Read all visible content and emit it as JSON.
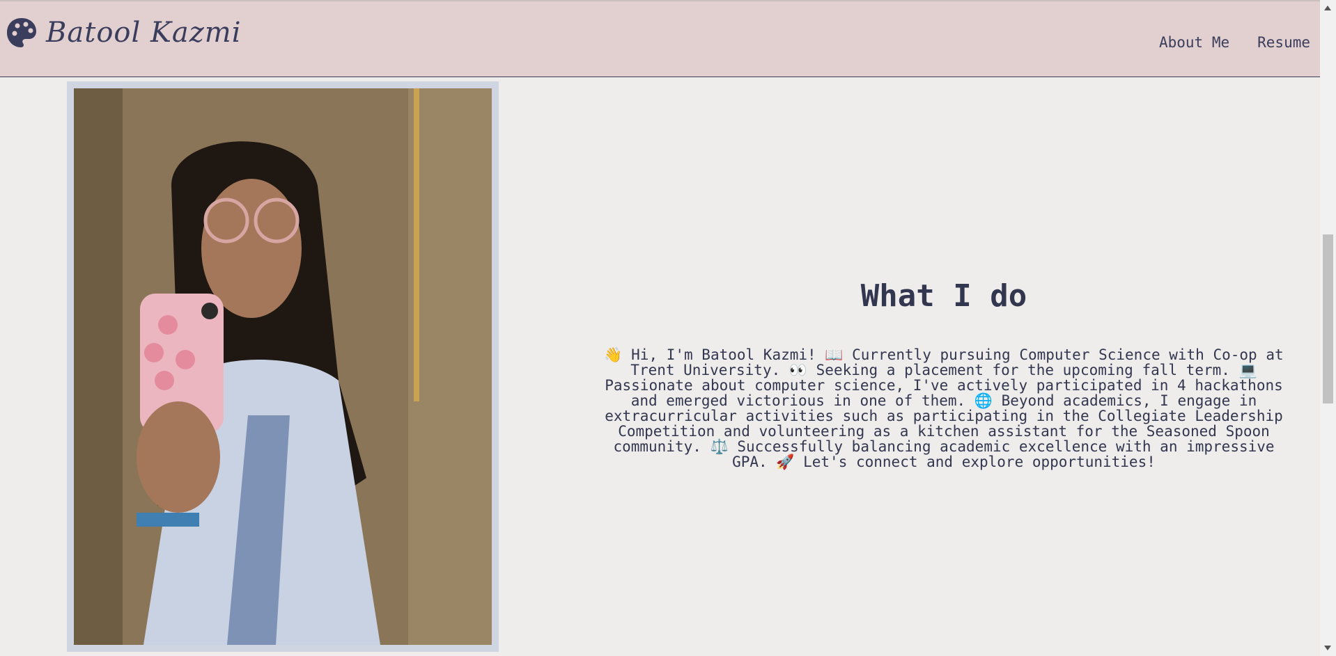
{
  "navbar": {
    "brand": "Batool Kazmi",
    "brand_icon": "palette-icon",
    "links": [
      {
        "label": "About Me"
      },
      {
        "label": "Resume"
      }
    ]
  },
  "hero": {
    "photo_subject": "portrait-photo",
    "title": "What I do",
    "bio": "👋 Hi, I'm Batool Kazmi! 📖 Currently pursuing Computer Science with Co-op at Trent University. 👀 Seeking a placement for the upcoming fall term. 💻 Passionate about computer science, I've actively participated in 4 hackathons and emerged victorious in one of them. 🌐 Beyond academics, I engage in extracurricular activities such as participating in the Collegiate Leadership Competition and volunteering as a kitchen assistant for the Seasoned Spoon community. ⚖️ Successfully balancing academic excellence with an impressive GPA. 🚀 Let's connect and explore opportunities!"
  },
  "colors": {
    "navbar_bg": "#e2cfcf",
    "page_bg": "#eeedec",
    "text": "#33364f",
    "photo_frame": "#cfd6e1"
  }
}
